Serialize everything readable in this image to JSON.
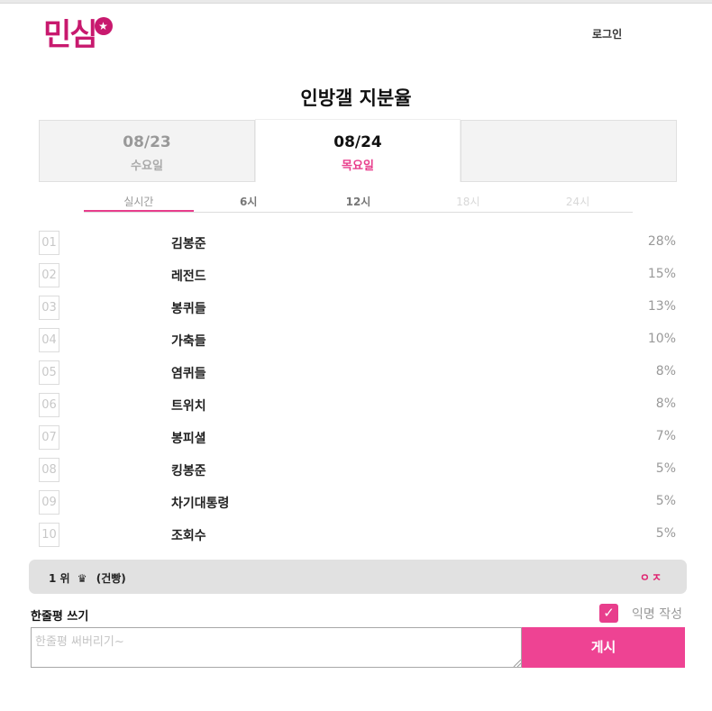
{
  "header": {
    "logo_text": "민심",
    "logo_star": "★",
    "login_label": "로그인"
  },
  "page_title": "인방갤 지분율",
  "date_tabs": [
    {
      "date": "08/23",
      "weekday": "수요일",
      "state": "inactive"
    },
    {
      "date": "08/24",
      "weekday": "목요일",
      "state": "selected"
    },
    {
      "date": "",
      "weekday": "",
      "state": "empty"
    }
  ],
  "time_tabs": [
    {
      "label": "실시간",
      "state": "active"
    },
    {
      "label": "6시",
      "state": "enabled"
    },
    {
      "label": "12시",
      "state": "enabled"
    },
    {
      "label": "18시",
      "state": "disabled"
    },
    {
      "label": "24시",
      "state": "disabled"
    }
  ],
  "ranking": [
    {
      "rank": "01",
      "name": "김봉준",
      "percent": "28%"
    },
    {
      "rank": "02",
      "name": "레전드",
      "percent": "15%"
    },
    {
      "rank": "03",
      "name": "봉퀴들",
      "percent": "13%"
    },
    {
      "rank": "04",
      "name": "가축들",
      "percent": "10%"
    },
    {
      "rank": "05",
      "name": "염퀴들",
      "percent": "8%"
    },
    {
      "rank": "06",
      "name": "트위치",
      "percent": "8%"
    },
    {
      "rank": "07",
      "name": "봉피셜",
      "percent": "7%"
    },
    {
      "rank": "08",
      "name": "킹봉준",
      "percent": "5%"
    },
    {
      "rank": "09",
      "name": "차기대통령",
      "percent": "5%"
    },
    {
      "rank": "10",
      "name": "조회수",
      "percent": "5%"
    }
  ],
  "winner": {
    "rank_label": "1 위",
    "crown_icon": "♛",
    "name": "(건빵)",
    "toggle_label": "ㅇㅈ"
  },
  "comment": {
    "label": "한줄평 쓰기",
    "anonymous_label": "익명 작성",
    "anonymous_checked": true,
    "placeholder": "한줄평 써버리기~",
    "value": "",
    "submit_label": "게시"
  },
  "colors": {
    "brand": "#c8196e",
    "accent": "#ee4393",
    "accent_text": "#e83e8c"
  }
}
